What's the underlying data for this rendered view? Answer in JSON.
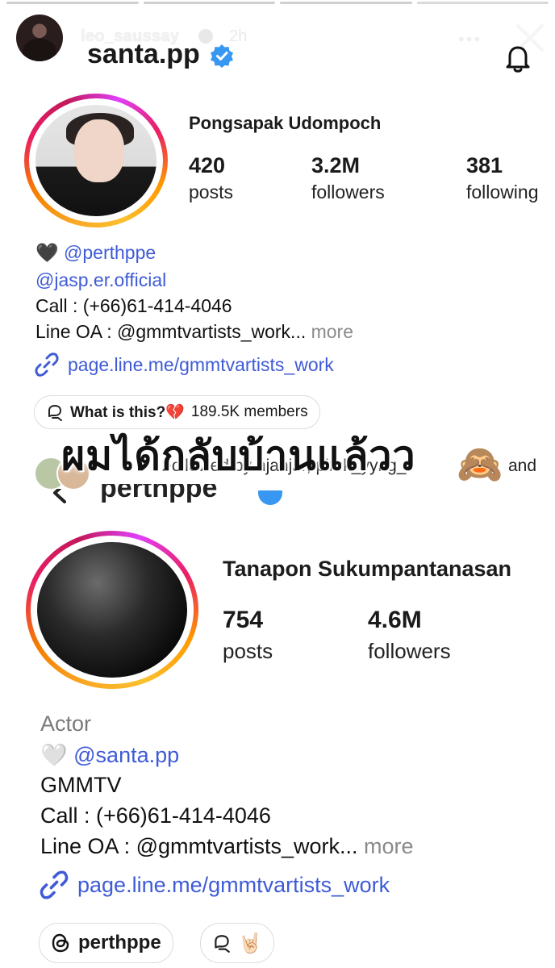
{
  "story": {
    "username": "leo_saussay",
    "time": "2h",
    "menu_icon": "more-dots-icon",
    "close_icon": "close-icon"
  },
  "overlay_header": {
    "name": "santa.pp",
    "verified_icon": "verified-badge-icon",
    "bell_icon": "bell-icon"
  },
  "profile1": {
    "full_name": "Pongsapak Udompoch",
    "stats": [
      {
        "num": "420",
        "label": "posts"
      },
      {
        "num": "3.2M",
        "label": "followers"
      },
      {
        "num": "381",
        "label": "following"
      }
    ],
    "bio": {
      "heart": "🖤",
      "mention1": "@perthppe",
      "mention2": "@jasp.er.official",
      "call": "Call : (+66)61-414-4046",
      "line_oa": "Line OA : @gmmtvartists_work...",
      "more": "more",
      "link": "page.line.me/gmmtvartists_work"
    },
    "channel_pill": {
      "icon": "channel-icon",
      "label": "What is this?💔",
      "members": "189.5K members"
    },
    "followed_by": "Followed by njanjar, pimk_yyng_",
    "followed_and": "and"
  },
  "caption": {
    "text": "ผมได้กลับบ้านแล้วว",
    "emoji": "🙈"
  },
  "cut_header": {
    "name": "perthppe"
  },
  "profile2": {
    "full_name": "Tanapon Sukumpantanasan",
    "stats": [
      {
        "num": "754",
        "label": "posts"
      },
      {
        "num": "4.6M",
        "label": "followers"
      }
    ],
    "bio": {
      "category": "Actor",
      "heart": "🤍",
      "mention": "@santa.pp",
      "org": "GMMTV",
      "call": "Call : (+66)61-414-4046",
      "line_oa": "Line OA : @gmmtvartists_work...",
      "more": "more",
      "link": "page.line.me/gmmtvartists_work"
    },
    "threads_pill": "perthppe",
    "channel_emoji": "🤘🏻"
  },
  "colors": {
    "link_blue": "#3f5bd6",
    "verified_blue": "#3897f0",
    "muted_gray": "#8a8a8a"
  }
}
